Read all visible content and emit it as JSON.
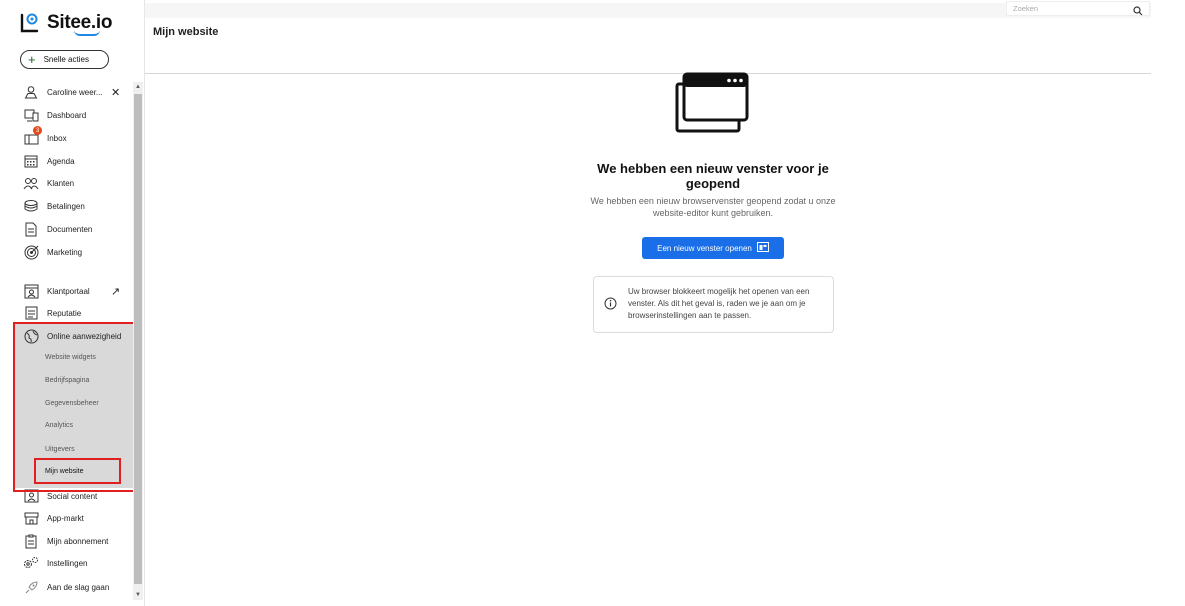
{
  "brand": {
    "name": "Sitee.io"
  },
  "quick_actions": {
    "label": "Snelle acties",
    "icon": "plus-icon"
  },
  "sidebar": {
    "items": [
      {
        "label": "Caroline weer...",
        "icon": "user-switch-icon",
        "extra": "✕"
      },
      {
        "label": "Dashboard",
        "icon": "dashboard-icon"
      },
      {
        "label": "Inbox",
        "icon": "inbox-icon",
        "badge": "3"
      },
      {
        "label": "Agenda",
        "icon": "calendar-icon"
      },
      {
        "label": "Klanten",
        "icon": "customers-icon"
      },
      {
        "label": "Betalingen",
        "icon": "payments-icon"
      },
      {
        "label": "Documenten",
        "icon": "document-icon"
      },
      {
        "label": "Marketing",
        "icon": "target-icon"
      },
      {
        "label": "Klantportaal",
        "icon": "portal-icon",
        "extra": "↗"
      },
      {
        "label": "Reputatie",
        "icon": "reputation-icon"
      },
      {
        "label": "Online aanwezigheid",
        "icon": "globe-icon"
      },
      {
        "label": "Social content",
        "icon": "social-icon"
      },
      {
        "label": "App-markt",
        "icon": "store-icon"
      },
      {
        "label": "Mijn abonnement",
        "icon": "subscription-icon"
      },
      {
        "label": "Instellingen",
        "icon": "settings-icon"
      },
      {
        "label": "Aan de slag gaan",
        "icon": "rocket-icon"
      }
    ],
    "submenu": [
      "Website widgets",
      "Bedrijfspagina",
      "Gegevensbeheer",
      "Analytics",
      "Uitgevers",
      "Mijn website"
    ]
  },
  "search": {
    "placeholder": "Zoeken"
  },
  "header": {
    "title": "Mijn website"
  },
  "main": {
    "heading": "We hebben een nieuw venster voor je geopend",
    "subtext": "We hebben een nieuw browservenster geopend zodat u onze website-editor kunt gebruiken.",
    "button_label": "Een nieuw venster openen",
    "info_text": "Uw browser blokkeert mogelijk het openen van een venster. Als dit het geval is, raden we je aan om je browserinstellingen aan te passen."
  },
  "colors": {
    "primary": "#1a6fe8",
    "highlight": "#e02020",
    "submenu_bg": "#d9d9d9"
  }
}
